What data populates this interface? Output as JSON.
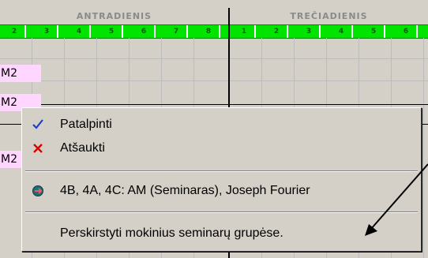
{
  "timetable": {
    "days": [
      "ANTRADIENIS",
      "TREČIADIENIS"
    ],
    "periods_tuesday": [
      "2",
      "3",
      "4",
      "5",
      "6",
      "7",
      "8"
    ],
    "periods_wednesday": [
      "1",
      "2",
      "3",
      "4",
      "5",
      "6"
    ],
    "lessons": [
      "M2",
      "M2",
      "M2"
    ]
  },
  "context_menu": {
    "items": [
      {
        "label": "Patalpinti",
        "icon": "checkmark-icon"
      },
      {
        "label": "Atšaukti",
        "icon": "cross-icon"
      },
      {
        "label": "4B, 4A, 4C: AM (Seminaras), Joseph Fourier",
        "icon": "lesson-bullet-icon"
      },
      {
        "label": "Perskirstyti mokinius seminarų grupėse.",
        "icon": ""
      }
    ]
  },
  "colors": {
    "period_header": "#00e400",
    "lesson_cell": "#ffd6ff",
    "check": "#1a3fd0",
    "cross": "#e00000"
  }
}
